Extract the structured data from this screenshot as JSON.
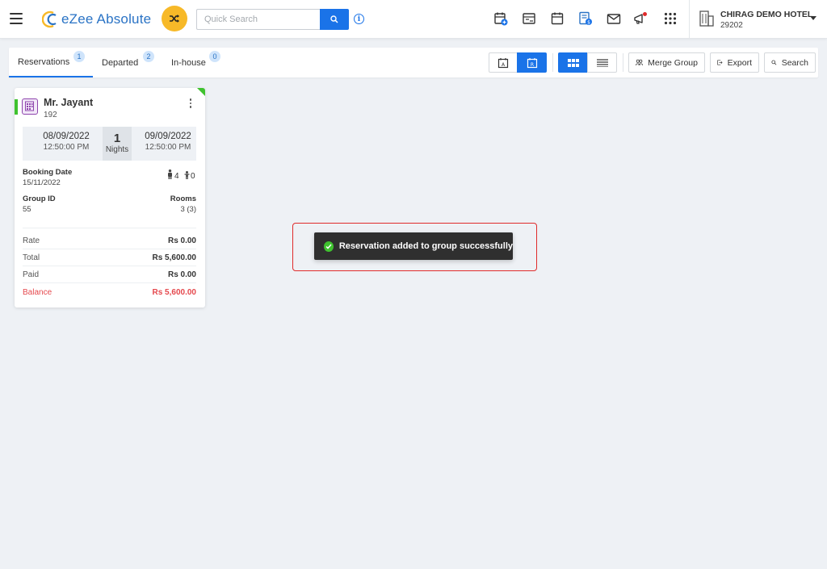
{
  "header": {
    "app_name": "eZee Absolute",
    "search_placeholder": "Quick Search",
    "hotel_name": "CHIRAG DEMO HOTEL",
    "hotel_code": "29202",
    "brand_color": "#1a73e8",
    "icons": [
      "menu-icon",
      "shuffle-icon",
      "search-icon",
      "info-icon",
      "calendar-add-icon",
      "calendar-checkin-icon",
      "calendar-icon",
      "billing-icon",
      "mail-icon",
      "announcement-icon",
      "apps-grid-icon",
      "building-icon"
    ]
  },
  "tabs": [
    {
      "label": "Reservations",
      "count": "1",
      "active": true
    },
    {
      "label": "Departed",
      "count": "2",
      "active": false
    },
    {
      "label": "In-house",
      "count": "0",
      "active": false
    }
  ],
  "actions": {
    "merge_group": "Merge Group",
    "export": "Export",
    "search": "Search"
  },
  "reservation": {
    "guest_name": "Mr. Jayant",
    "reservation_no": "192",
    "arrival_date": "08/09/2022",
    "arrival_time": "12:50:00 PM",
    "nights": "1",
    "nights_label": "Nights",
    "departure_date": "09/09/2022",
    "departure_time": "12:50:00 PM",
    "booking_date_label": "Booking Date",
    "booking_date": "15/11/2022",
    "adults": "4",
    "children": "0",
    "group_id_label": "Group ID",
    "group_id": "55",
    "rooms_label": "Rooms",
    "rooms": "3 (3)",
    "rate_label": "Rate",
    "rate": "Rs 0.00",
    "total_label": "Total",
    "total": "Rs 5,600.00",
    "paid_label": "Paid",
    "paid": "Rs 0.00",
    "balance_label": "Balance",
    "balance": "Rs 5,600.00",
    "status_color": "#3fc22f",
    "balance_color": "#e5484d"
  },
  "toast": {
    "message": "Reservation added to group successfully"
  }
}
